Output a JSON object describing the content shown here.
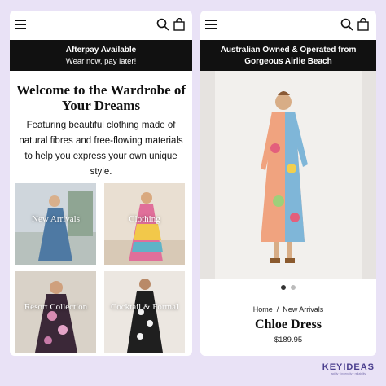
{
  "left": {
    "banner": {
      "bold": "Afterpay Available",
      "sub": "Wear now, pay later!"
    },
    "welcome_title": "Welcome to the Wardrobe of Your Dreams",
    "intro": "Featuring beautiful clothing made of natural fibres and free-flowing materials to help you express your own unique style.",
    "tiles": [
      {
        "label": "New Arrivals"
      },
      {
        "label": "Clothing"
      },
      {
        "label": "Resort Collection"
      },
      {
        "label": "Cocktail & Formal"
      }
    ]
  },
  "right": {
    "banner": {
      "bold": "Australian Owned & Operated from Gorgeous Airlie Beach"
    },
    "breadcrumb": {
      "home": "Home",
      "current": "New Arrivals"
    },
    "product_name": "Chloe Dress",
    "price": "$189.95",
    "carousel": {
      "total": 2,
      "active": 1
    }
  },
  "logo": {
    "name": "KEYIDEAS",
    "tagline": "agility · ingenuity · reliability"
  },
  "colors": {
    "background": "#e9e2f6",
    "banner": "#111111",
    "brand": "#4b3f8f"
  }
}
